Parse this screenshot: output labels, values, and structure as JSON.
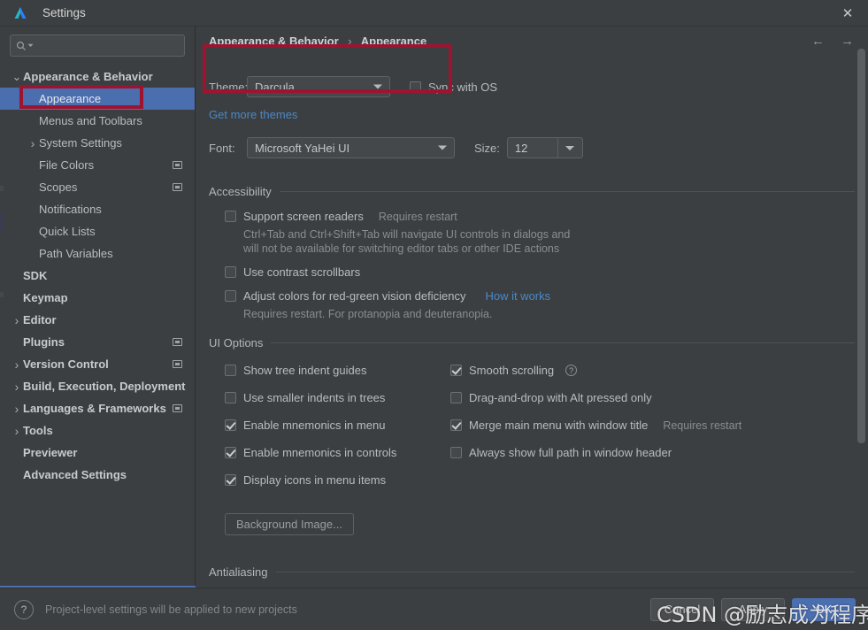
{
  "window": {
    "title": "Settings",
    "app_icon": "intellij-logo-icon",
    "close_label": "✕"
  },
  "sidebar": {
    "search": {
      "value": "",
      "placeholder": "",
      "icon": "search-icon"
    },
    "items": [
      {
        "label": "Appearance & Behavior",
        "level": 0,
        "chevron": "down",
        "bold": true,
        "selected": false,
        "badge": false
      },
      {
        "label": "Appearance",
        "level": 1,
        "chevron": "",
        "bold": false,
        "selected": true,
        "badge": false
      },
      {
        "label": "Menus and Toolbars",
        "level": 1,
        "chevron": "",
        "bold": false,
        "selected": false,
        "badge": false
      },
      {
        "label": "System Settings",
        "level": 1,
        "chevron": "right",
        "bold": false,
        "selected": false,
        "badge": false
      },
      {
        "label": "File Colors",
        "level": 1,
        "chevron": "",
        "bold": false,
        "selected": false,
        "badge": true
      },
      {
        "label": "Scopes",
        "level": 1,
        "chevron": "",
        "bold": false,
        "selected": false,
        "badge": true
      },
      {
        "label": "Notifications",
        "level": 1,
        "chevron": "",
        "bold": false,
        "selected": false,
        "badge": false
      },
      {
        "label": "Quick Lists",
        "level": 1,
        "chevron": "",
        "bold": false,
        "selected": false,
        "badge": false
      },
      {
        "label": "Path Variables",
        "level": 1,
        "chevron": "",
        "bold": false,
        "selected": false,
        "badge": false
      },
      {
        "label": "SDK",
        "level": 0,
        "chevron": "",
        "bold": true,
        "selected": false,
        "badge": false
      },
      {
        "label": "Keymap",
        "level": 0,
        "chevron": "",
        "bold": true,
        "selected": false,
        "badge": false
      },
      {
        "label": "Editor",
        "level": 0,
        "chevron": "right",
        "bold": true,
        "selected": false,
        "badge": false
      },
      {
        "label": "Plugins",
        "level": 0,
        "chevron": "",
        "bold": true,
        "selected": false,
        "badge": true
      },
      {
        "label": "Version Control",
        "level": 0,
        "chevron": "right",
        "bold": true,
        "selected": false,
        "badge": true
      },
      {
        "label": "Build, Execution, Deployment",
        "level": 0,
        "chevron": "right",
        "bold": true,
        "selected": false,
        "badge": false
      },
      {
        "label": "Languages & Frameworks",
        "level": 0,
        "chevron": "right",
        "bold": true,
        "selected": false,
        "badge": true
      },
      {
        "label": "Tools",
        "level": 0,
        "chevron": "right",
        "bold": true,
        "selected": false,
        "badge": false
      },
      {
        "label": "Previewer",
        "level": 0,
        "chevron": "",
        "bold": true,
        "selected": false,
        "badge": false
      },
      {
        "label": "Advanced Settings",
        "level": 0,
        "chevron": "",
        "bold": true,
        "selected": false,
        "badge": false
      }
    ]
  },
  "breadcrumb": {
    "root": "Appearance & Behavior",
    "separator": "›",
    "leaf": "Appearance"
  },
  "nav": {
    "back": "←",
    "forward": "→"
  },
  "appearance": {
    "theme_label": "Theme:",
    "theme_value": "Darcula",
    "sync_with_os_label": "Sync with OS",
    "sync_with_os_checked": false,
    "get_more_themes": "Get more themes",
    "font_label": "Font:",
    "font_value": "Microsoft YaHei UI",
    "size_label": "Size:",
    "size_value": "12"
  },
  "accessibility": {
    "heading": "Accessibility",
    "items": [
      {
        "label": "Support screen readers",
        "checked": false,
        "hint": "Requires restart",
        "desc_line1": "Ctrl+Tab and Ctrl+Shift+Tab will navigate UI controls in dialogs and",
        "desc_line2": "will not be available for switching editor tabs or other IDE actions"
      },
      {
        "label": "Use contrast scrollbars",
        "checked": false,
        "hint": "",
        "desc_line1": "",
        "desc_line2": ""
      },
      {
        "label": "Adjust colors for red-green vision deficiency",
        "checked": false,
        "link": "How it works",
        "desc_line1": "Requires restart. For protanopia and deuteranopia.",
        "desc_line2": ""
      }
    ]
  },
  "ui_options": {
    "heading": "UI Options",
    "left_column": [
      {
        "label": "Show tree indent guides",
        "checked": false
      },
      {
        "label": "Use smaller indents in trees",
        "checked": false
      },
      {
        "label": "Enable mnemonics in menu",
        "checked": true
      },
      {
        "label": "Enable mnemonics in controls",
        "checked": true
      },
      {
        "label": "Display icons in menu items",
        "checked": true
      }
    ],
    "right_column": [
      {
        "label": "Smooth scrolling",
        "checked": true,
        "help": "?",
        "hint": ""
      },
      {
        "label": "Drag-and-drop with Alt pressed only",
        "checked": false,
        "help": "",
        "hint": ""
      },
      {
        "label": "Merge main menu with window title",
        "checked": true,
        "help": "",
        "hint": "Requires restart"
      },
      {
        "label": "Always show full path in window header",
        "checked": false,
        "help": "",
        "hint": ""
      }
    ],
    "background_image_button": "Background Image..."
  },
  "antialiasing": {
    "heading": "Antialiasing"
  },
  "bottom": {
    "help_icon": "?",
    "note": "Project-level settings will be applied to new projects",
    "buttons": [
      {
        "label": "Cancel",
        "primary": false
      },
      {
        "label": "Apply",
        "primary": false
      },
      {
        "label": "OK",
        "primary": true
      }
    ]
  },
  "watermark": {
    "text": "CSDN @励志成为程序媛"
  },
  "colors": {
    "window_bg": "#3c3f41",
    "selection_blue": "#4b6eaf",
    "link_blue": "#4a88c7",
    "annotation_red": "#9e1430"
  }
}
